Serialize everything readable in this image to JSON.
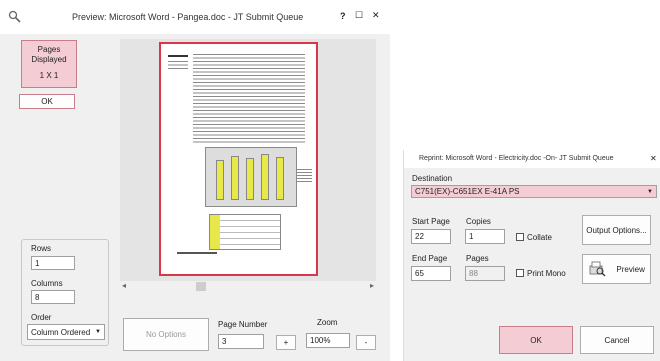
{
  "preview_window": {
    "title": "Preview:  Microsoft Word - Pangea.doc  -  JT Submit Queue",
    "title_buttons": {
      "help": "?",
      "maximize": "☐",
      "close": "✕"
    },
    "pages_displayed_label": "Pages\nDisplayed",
    "pages_displayed_value": "1 X 1",
    "ok_label": "OK",
    "rows_label": "Rows",
    "rows_value": "1",
    "columns_label": "Columns",
    "columns_value": "8",
    "order_label": "Order",
    "order_value": "Column Ordered",
    "no_options_label": "No Options",
    "page_number_label": "Page Number",
    "page_number_value": "3",
    "plus_label": "+",
    "zoom_label": "Zoom",
    "zoom_value": "100%",
    "minus_label": "-",
    "scroll_left": "◂",
    "scroll_right": "▸"
  },
  "reprint_dialog": {
    "title": "Reprint:  Microsoft Word - Electricity.doc  -On-  JT Submit Queue",
    "close": "✕",
    "destination_label": "Destination",
    "destination_value": "C751(EX)-C651EX E-41A PS",
    "start_page_label": "Start Page",
    "start_page_value": "22",
    "copies_label": "Copies",
    "copies_value": "1",
    "collate_label": "Collate",
    "end_page_label": "End Page",
    "end_page_value": "65",
    "pages_label": "Pages",
    "pages_value": "88",
    "print_mono_label": "Print Mono",
    "output_options_label": "Output Options...",
    "preview_label": "Preview",
    "ok_label": "OK",
    "cancel_label": "Cancel"
  },
  "colors": {
    "accent_pink": "#f4ccd3",
    "accent_border": "#c97d8a",
    "page_border": "#d9364a",
    "chart_bar": "#e8e84a",
    "chart_frame": "#8a8a8a",
    "table_highlight": "#e8e84a"
  },
  "icons": {
    "preview_window_icon": "magnifier-icon",
    "preview_button_icon": "print-preview-icon"
  }
}
